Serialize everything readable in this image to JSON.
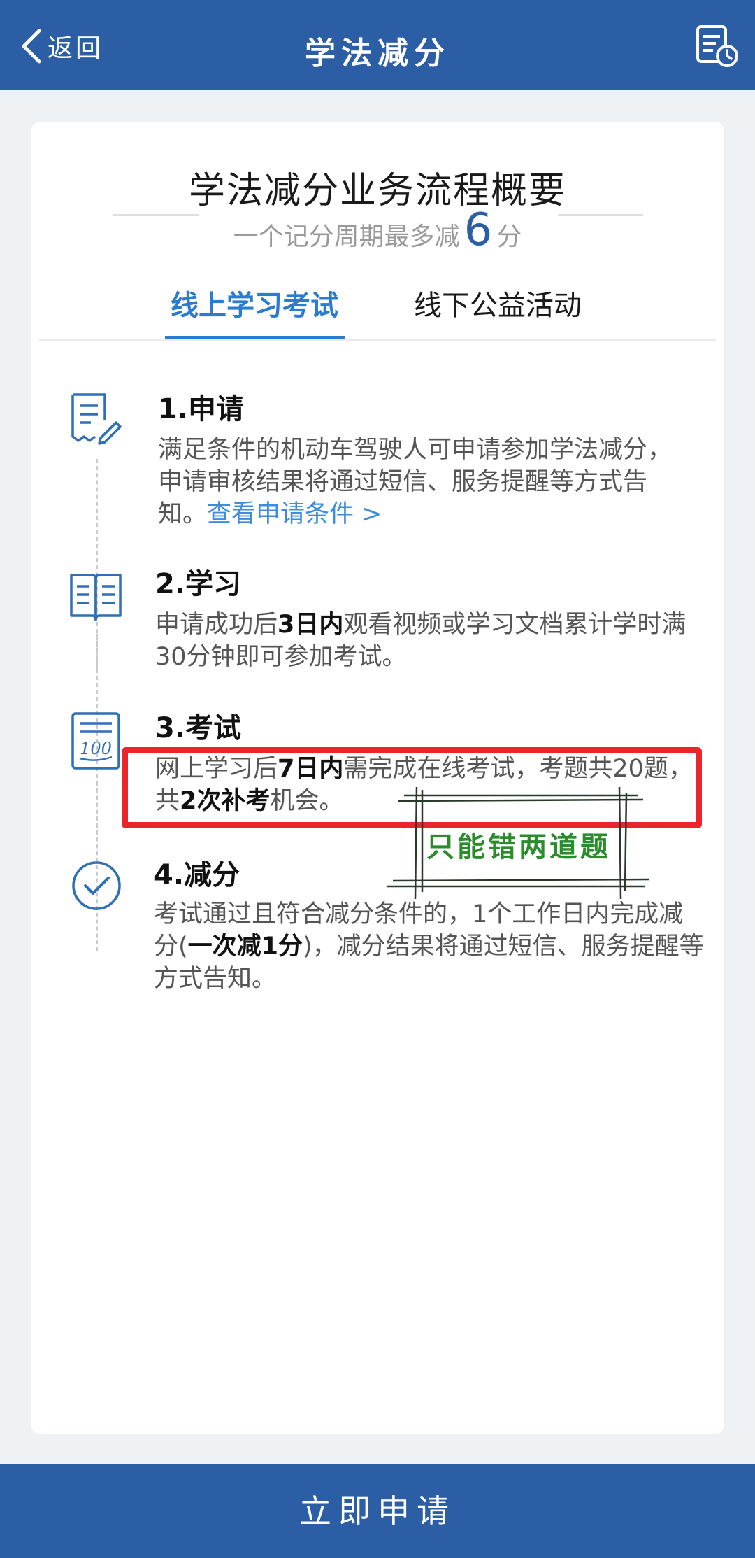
{
  "header": {
    "back_label": "返回",
    "title": "学法减分"
  },
  "card": {
    "title": "学法减分业务流程概要",
    "subtitle_prefix": "一个记分周期最多减",
    "subtitle_number": "6",
    "subtitle_suffix": "分"
  },
  "tabs": [
    {
      "label": "线上学习考试",
      "active": true
    },
    {
      "label": "线下公益活动",
      "active": false
    }
  ],
  "steps": [
    {
      "heading": "1.申请",
      "body": "满足条件的机动车驾驶人可申请参加学法减分，申请审核结果将通过短信、服务提醒等方式告知。",
      "link": "查看申请条件 >",
      "icon": "application-form-icon"
    },
    {
      "heading": "2.学习",
      "body_pre": "申请成功后",
      "body_bold": "3日内",
      "body_post": "观看视频或学习文档累计学时满30分钟即可参加考试。",
      "icon": "book-icon"
    },
    {
      "heading": "3.考试",
      "body_pre": "网上学习后",
      "body_bold": "7日内",
      "body_mid": "需完成在线考试，考题共20题，共",
      "body_bold2": "2次补考",
      "body_post": "机会。",
      "icon": "exam-paper-icon"
    },
    {
      "heading": "4.减分",
      "body_pre": "考试通过且符合减分条件的，1个工作日内完成减分(",
      "body_bold": "一次减1分",
      "body_post": ")，减分结果将通过短信、服务提醒等方式告知。",
      "icon": "check-circle-icon"
    }
  ],
  "annotation": {
    "text": "只能错两道题",
    "highlight_color": "#e8262c",
    "stamp_color": "#2b8c2b"
  },
  "apply_button": "立即申请",
  "colors": {
    "brand": "#2b5ea4",
    "accent": "#2b7bd0",
    "link": "#3c8de0"
  }
}
